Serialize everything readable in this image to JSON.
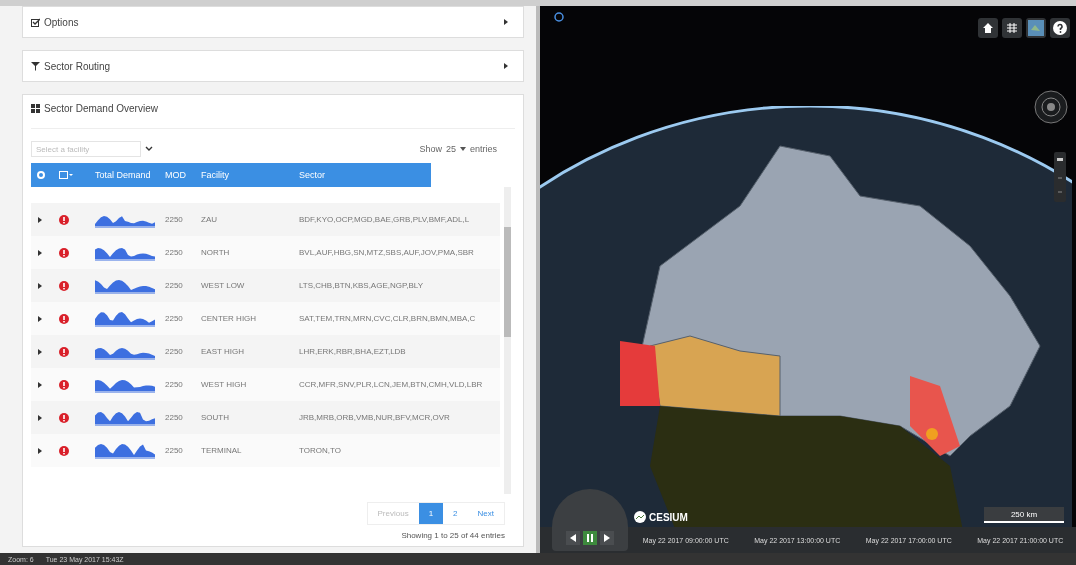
{
  "accordions": [
    {
      "kind": "check",
      "title": "Options",
      "expanded": false
    },
    {
      "kind": "filter",
      "title": "Sector Routing",
      "expanded": false
    }
  ],
  "table_card": {
    "title": "Sector Demand Overview",
    "facility_select": {
      "placeholder": "Select a facility"
    },
    "length": {
      "before": "Show",
      "value": "25",
      "after": "entries"
    },
    "columns": [
      "Total Demand",
      "MOD",
      "Facility",
      "Sector"
    ],
    "rows": [
      {
        "alert": true,
        "mod": "2250",
        "facility": "ZAU",
        "sector": "BDF,KYO,OCP,MGD,BAE,GRB,PLV,BMF,ADL,L"
      },
      {
        "alert": true,
        "mod": "2250",
        "facility": "NORTH",
        "sector": "BVL,AUF,HBG,SN,MTZ,SBS,AUF,JOV,PMA,SBR"
      },
      {
        "alert": true,
        "mod": "2250",
        "facility": "WEST LOW",
        "sector": "LTS,CHB,BTN,KBS,AGE,NGP,BLY"
      },
      {
        "alert": true,
        "mod": "2250",
        "facility": "CENTER HIGH",
        "sector": "SAT,TEM,TRN,MRN,CVC,CLR,BRN,BMN,MBA,C"
      },
      {
        "alert": true,
        "mod": "2250",
        "facility": "EAST HIGH",
        "sector": "LHR,ERK,RBR,BHA,EZT,LDB"
      },
      {
        "alert": true,
        "mod": "2250",
        "facility": "WEST HIGH",
        "sector": "CCR,MFR,SNV,PLR,LCN,JEM,BTN,CMH,VLD,LBR"
      },
      {
        "alert": true,
        "mod": "2250",
        "facility": "SOUTH",
        "sector": "JRB,MRB,ORB,VMB,NUR,BFV,MCR,OVR"
      },
      {
        "alert": true,
        "mod": "2250",
        "facility": "TERMINAL",
        "sector": "TORON,TO"
      }
    ],
    "pages": [
      {
        "label": "Previous",
        "selected": false,
        "disabled": true
      },
      {
        "label": "1",
        "selected": true,
        "disabled": false
      },
      {
        "label": "2",
        "selected": false,
        "disabled": false
      },
      {
        "label": "Next",
        "selected": false,
        "disabled": false
      }
    ],
    "info": "Showing 1 to 25 of 44 entries"
  },
  "map": {
    "logo": "CESIUM",
    "scale": "250 km",
    "timeline": [
      "May 22 2017 09:00:00 UTC",
      "May 22 2017 13:00:00 UTC",
      "May 22 2017 17:00:00 UTC",
      "May 22 2017 21:00:00 UTC"
    ],
    "playing": true
  },
  "status_bar": {
    "left": "Zoom: 6",
    "right": "Tue 23 May 2017 15:43Z"
  }
}
